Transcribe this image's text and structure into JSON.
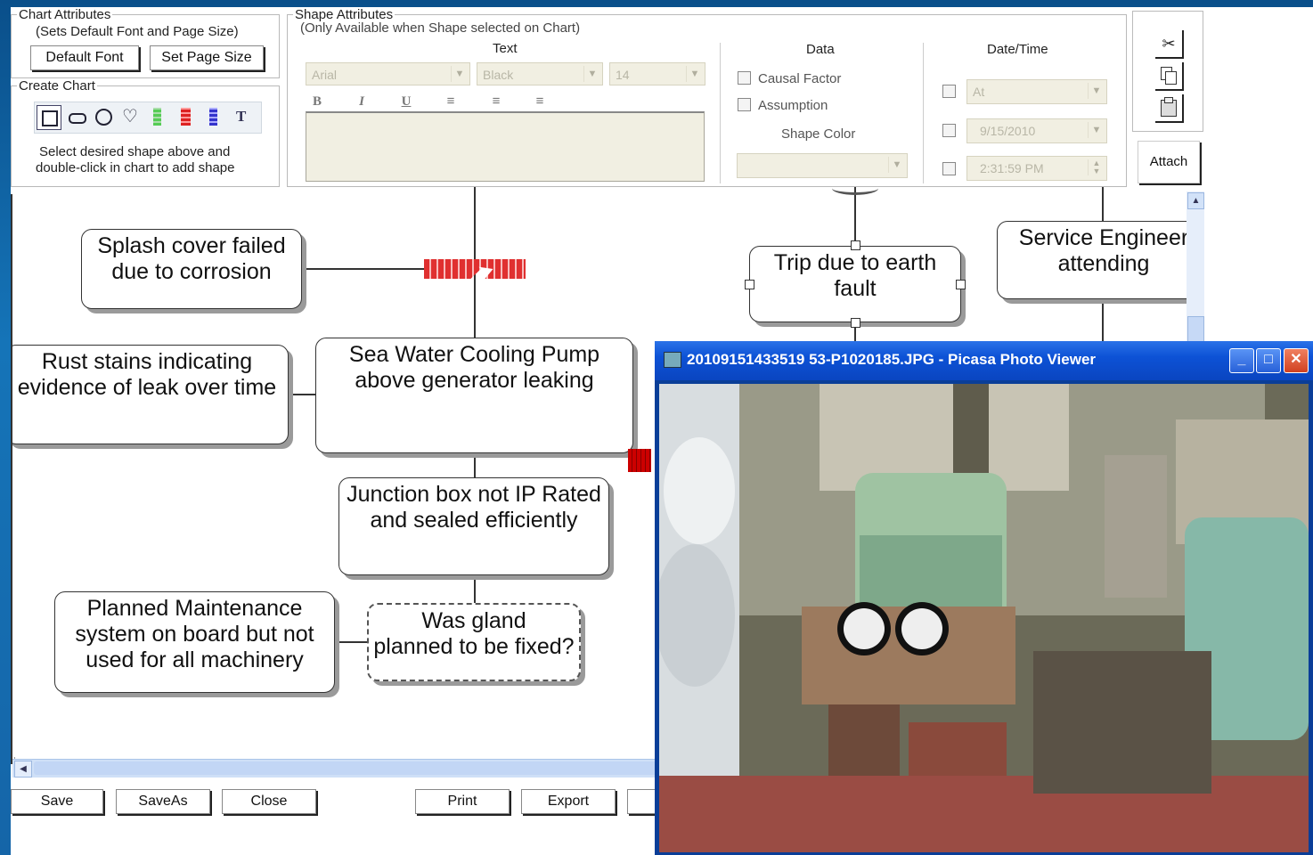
{
  "chart_attributes": {
    "legend": "Chart Attributes",
    "subtitle": "(Sets Default Font and Page Size)",
    "default_font_label": "Default Font",
    "set_page_size_label": "Set Page Size"
  },
  "create_chart": {
    "legend": "Create Chart",
    "hint_line1": "Select desired shape above and",
    "hint_line2": "double-click in chart to add shape",
    "shape_tools": [
      "rectangle-tool-icon",
      "rounded-rect-tool-icon",
      "circle-tool-icon",
      "shield-tool-icon",
      "green-bar-tool-icon",
      "red-bar-tool-icon",
      "blue-bar-tool-icon",
      "text-tool-icon"
    ]
  },
  "shape_attributes": {
    "legend": "Shape Attributes",
    "subtitle": "(Only Available when Shape selected on Chart)",
    "text_heading": "Text",
    "font": "Arial",
    "color": "Black",
    "size": "14",
    "bold": "B",
    "italic": "I",
    "underline": "U"
  },
  "data_panel": {
    "heading": "Data",
    "causal_factor": "Causal Factor",
    "assumption": "Assumption",
    "shape_color": "Shape Color"
  },
  "datetime_panel": {
    "heading": "Date/Time",
    "at": "At",
    "date": "9/15/2010",
    "time": "2:31:59 PM"
  },
  "clipboard": {
    "cut_icon": "scissors-icon",
    "copy_icon": "copy-icon",
    "paste_icon": "paste-icon",
    "attach_label": "Attach"
  },
  "nodes": {
    "splash_line1": "Splash cover failed",
    "splash_line2": "due to corrosion",
    "rust_line1": "Rust stains indicating",
    "rust_line2": "evidence of leak over time",
    "pump_line1": "Sea Water Cooling Pump",
    "pump_line2": "above generator leaking",
    "junction_line1": "Junction box not IP Rated",
    "junction_line2": "and sealed efficiently",
    "planned_line1": "Planned Maintenance",
    "planned_line2": "system on board but not",
    "planned_line3": "used for all machinery",
    "gland_line1": "Was gland",
    "gland_line2": "planned to be fixed?",
    "trip_line1": "Trip due to earth",
    "trip_line2": "fault",
    "service_line1": "Service Engineer",
    "service_line2": "attending"
  },
  "bottom_buttons": {
    "save": "Save",
    "saveas": "SaveAs",
    "close": "Close",
    "print": "Print",
    "export": "Export"
  },
  "picasa": {
    "title": "20109151433519 53-P1020185.JPG - Picasa Photo Viewer",
    "minimize": "_",
    "maximize": "□",
    "close": "✕"
  }
}
